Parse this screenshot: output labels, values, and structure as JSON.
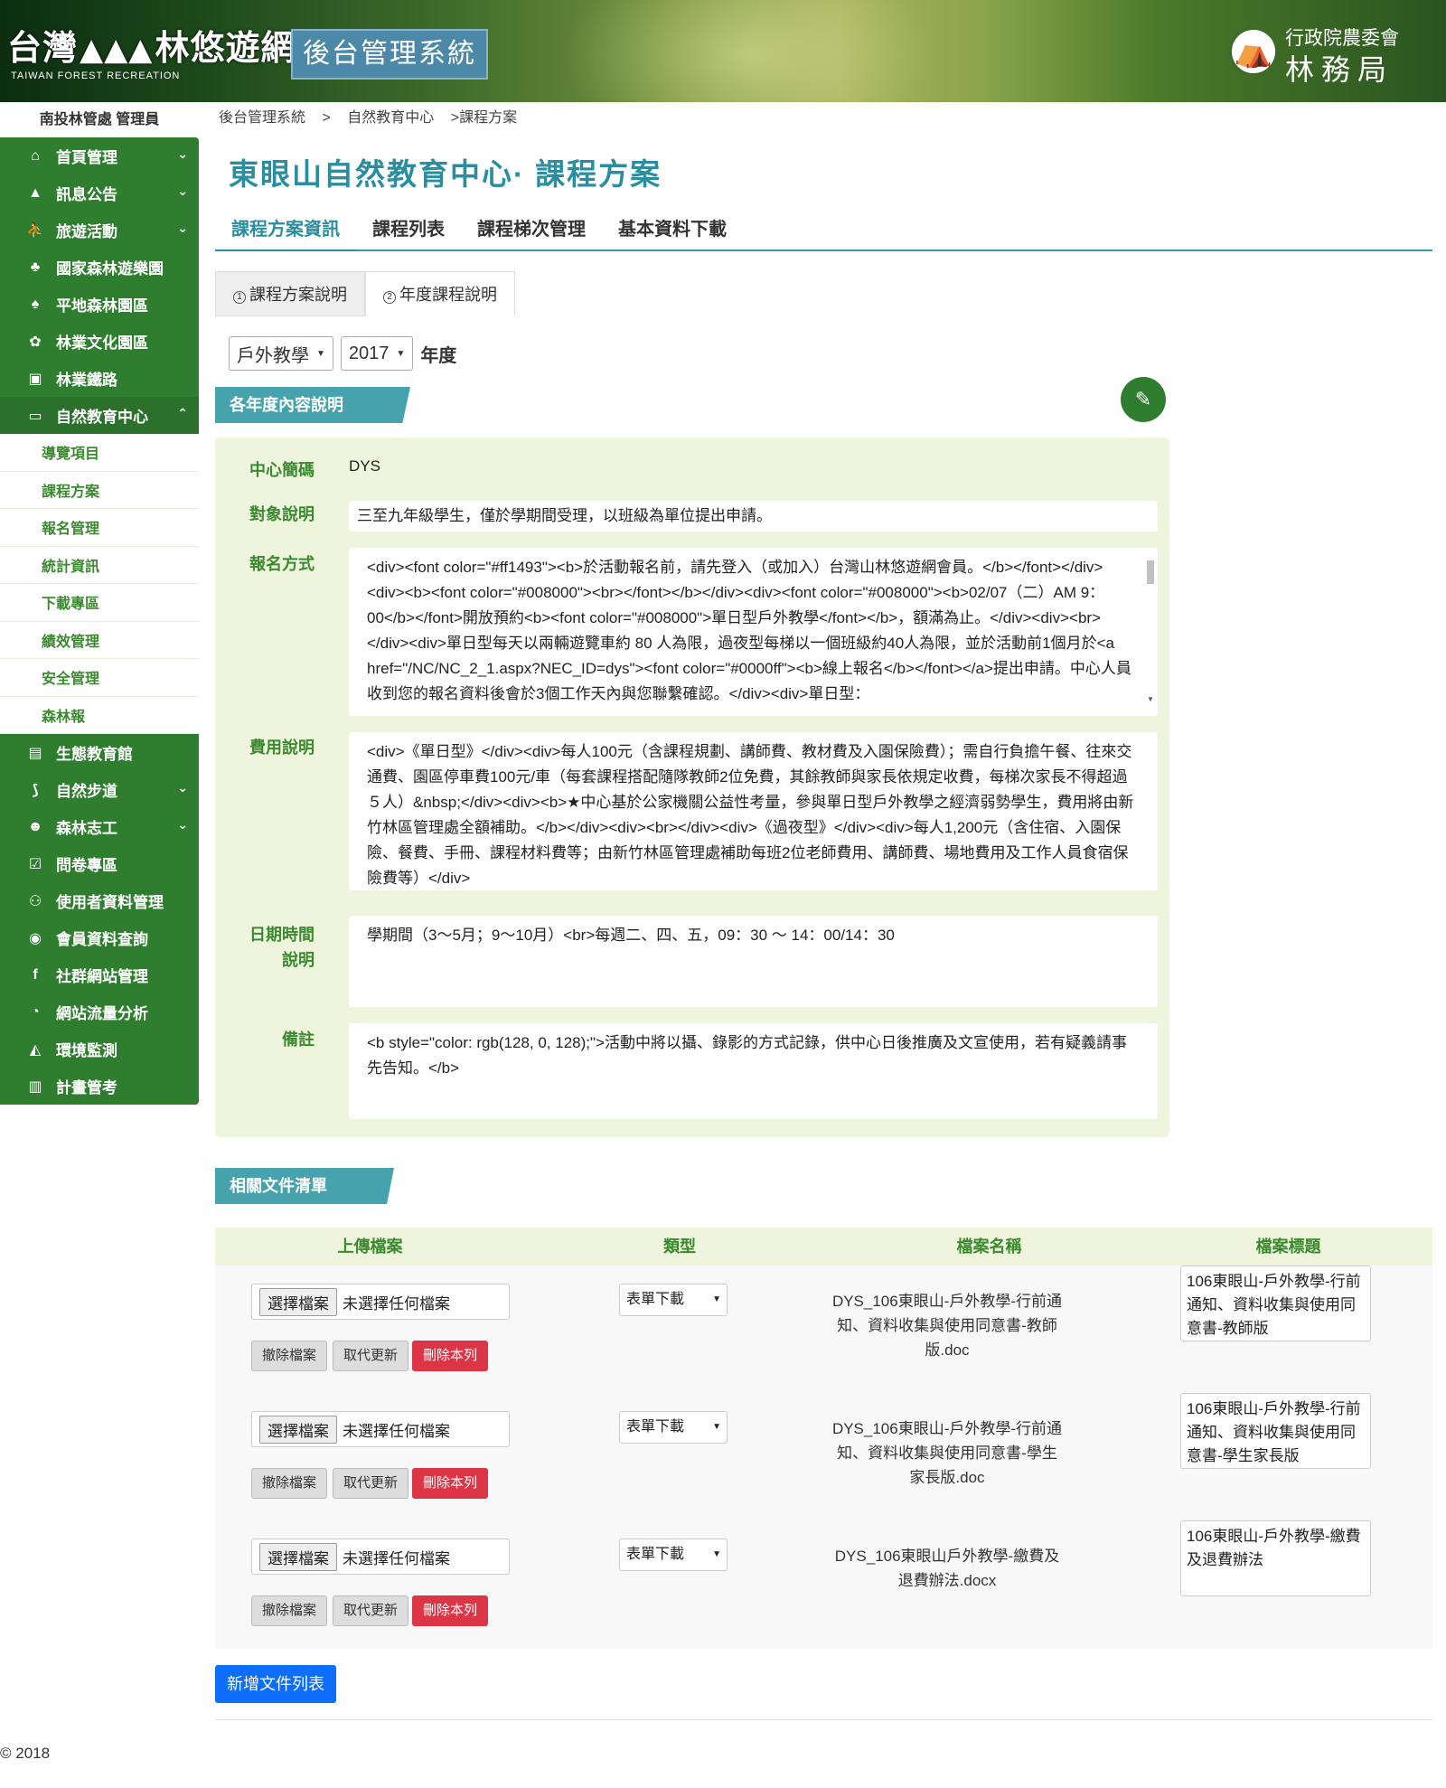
{
  "header": {
    "logo_text": "台灣",
    "logo_text2": "林悠遊網",
    "logo_sub": "TAIWAN FOREST RECREATION",
    "system_title": "後台管理系統",
    "agency_line1": "行政院農委會",
    "agency_line2": "林務局"
  },
  "user": "南投林管處 管理員",
  "sidebar": {
    "items": [
      {
        "label": "首頁管理",
        "icon": "home-tree-icon",
        "chev": "⌄"
      },
      {
        "label": "訊息公告",
        "icon": "warning-icon",
        "chev": "⌄"
      },
      {
        "label": "旅遊活動",
        "icon": "hiking-icon",
        "chev": "⌄"
      },
      {
        "label": "國家森林遊樂園",
        "icon": "tree-icon",
        "chev": ""
      },
      {
        "label": "平地森林園區",
        "icon": "forest-icon",
        "chev": ""
      },
      {
        "label": "林業文化園區",
        "icon": "culture-icon",
        "chev": ""
      },
      {
        "label": "林業鐵路",
        "icon": "train-icon",
        "chev": ""
      },
      {
        "label": "自然教育中心",
        "icon": "graduation-cap-icon",
        "chev": "⌃"
      }
    ],
    "sub_items": [
      "導覽項目",
      "課程方案",
      "報名管理",
      "統計資訊",
      "下載專區",
      "績效管理",
      "安全管理",
      "森林報"
    ],
    "items_after": [
      {
        "label": "生態教育館",
        "icon": "building-icon",
        "chev": ""
      },
      {
        "label": "自然步道",
        "icon": "trail-icon",
        "chev": "⌄"
      },
      {
        "label": "森林志工",
        "icon": "volunteer-icon",
        "chev": "⌄"
      },
      {
        "label": "問卷專區",
        "icon": "survey-icon",
        "chev": ""
      },
      {
        "label": "使用者資料管理",
        "icon": "user-admin-icon",
        "chev": ""
      },
      {
        "label": "會員資料查詢",
        "icon": "member-icon",
        "chev": ""
      },
      {
        "label": "社群網站管理",
        "icon": "facebook-icon",
        "chev": ""
      },
      {
        "label": "網站流量分析",
        "icon": "traffic-icon",
        "chev": ""
      },
      {
        "label": "環境監測",
        "icon": "mountain-icon",
        "chev": ""
      },
      {
        "label": "計畫管考",
        "icon": "clipboard-icon",
        "chev": ""
      }
    ]
  },
  "breadcrumb": [
    "後台管理系統",
    ">",
    "自然教育中心",
    ">課程方案"
  ],
  "page_title": "東眼山自然教育中心· 課程方案",
  "tabs": [
    "課程方案資訊",
    "課程列表",
    "課程梯次管理",
    "基本資料下載"
  ],
  "subtabs": [
    {
      "num": "1",
      "label": "課程方案說明"
    },
    {
      "num": "2",
      "label": "年度課程說明"
    }
  ],
  "filters": {
    "type": "戶外教學",
    "year": "2017",
    "year_label": "年度"
  },
  "section1_title": "各年度內容說明",
  "fields": {
    "code_label": "中心簡碼",
    "code_value": "DYS",
    "target_label": "對象說明",
    "target_value": "三至九年級學生，僅於學期間受理，以班級為單位提出申請。",
    "signup_label": "報名方式",
    "signup_value": "<div><font color=\"#ff1493\"><b>於活動報名前，請先登入（或加入）台灣山林悠遊網會員。</b></font></div><div><b><font color=\"#008000\"><br></font></b></div><div><font color=\"#008000\"><b>02/07（二）AM 9：00</b></font>開放預約<b><font color=\"#008000\">單日型戶外教學</font></b>，額滿為止。</div><div><br></div><div>單日型每天以兩輛遊覽車約 80 人為限，過夜型每梯以一個班級約40人為限，並於活動前1個月於<a href=\"/NC/NC_2_1.aspx?NEC_ID=dys\"><font color=\"#0000ff\"><b>線上報名</b></font></a>提出申請。中心人員收到您的報名資料後會於3個工作天內與您聯繫確認。</div><div>單日型：",
    "fee_label": "費用說明",
    "fee_value": "<div>《單日型》</div><div>每人100元（含課程規劃、講師費、教材費及入園保險費）；需自行負擔午餐、往來交通費、園區停車費100元/車（每套課程搭配隨隊教師2位免費，其餘教師與家長依規定收費，每梯次家長不得超過５人）&nbsp;</div><div><b>★中心基於公家機關公益性考量，參與單日型戶外教學之經濟弱勢學生，費用將由新竹林區管理處全額補助。</b></div><div><br></div><div>《過夜型》</div><div>每人1,200元（含住宿、入園保險、餐費、手冊、課程材料費等；由新竹林區管理處補助每班2位老師費用、講師費、場地費用及工作人員食宿保險費等）</div>",
    "date_label1": "日期時間",
    "date_label2": "說明",
    "date_value": "學期間（3～5月；9～10月）<br>每週二、四、五，09：30 ～ 14：00/14：30",
    "note_label": "備註",
    "note_value": "<b style=\"color: rgb(128, 0, 128);\">活動中將以攝、錄影的方式記錄，供中心日後推廣及文宣使用，若有疑義請事先告知。</b>"
  },
  "section2_title": "相關文件清單",
  "doc_table": {
    "headers": [
      "上傳檔案",
      "類型",
      "檔案名稱",
      "檔案標題"
    ],
    "choose_btn": "選擇檔案",
    "no_file": "未選擇任何檔案",
    "btn_revoke": "撤除檔案",
    "btn_replace": "取代更新",
    "btn_delete": "刪除本列",
    "rows": [
      {
        "type": "表單下載",
        "filename": "DYS_106東眼山-戶外教學-行前通知、資料收集與使用同意書-教師版.doc",
        "title": "106東眼山-戶外教學-行前通知、資料收集與使用同意書-教師版"
      },
      {
        "type": "表單下載",
        "filename": "DYS_106東眼山-戶外教學-行前通知、資料收集與使用同意書-學生家長版.doc",
        "title": "106東眼山-戶外教學-行前通知、資料收集與使用同意書-學生家長版"
      },
      {
        "type": "表單下載",
        "filename": "DYS_106東眼山戶外教學-繳費及退費辦法.docx",
        "title": "106東眼山-戶外教學-繳費及退費辦法"
      }
    ]
  },
  "add_button": "新增文件列表",
  "copyright": "© 2018",
  "colors": {
    "sidebar_green": "#2f7d2f",
    "accent_teal": "#2b8ea0",
    "panel_bg": "#eef5dc",
    "delete_red": "#dc3545",
    "primary_blue": "#0d6efd"
  }
}
